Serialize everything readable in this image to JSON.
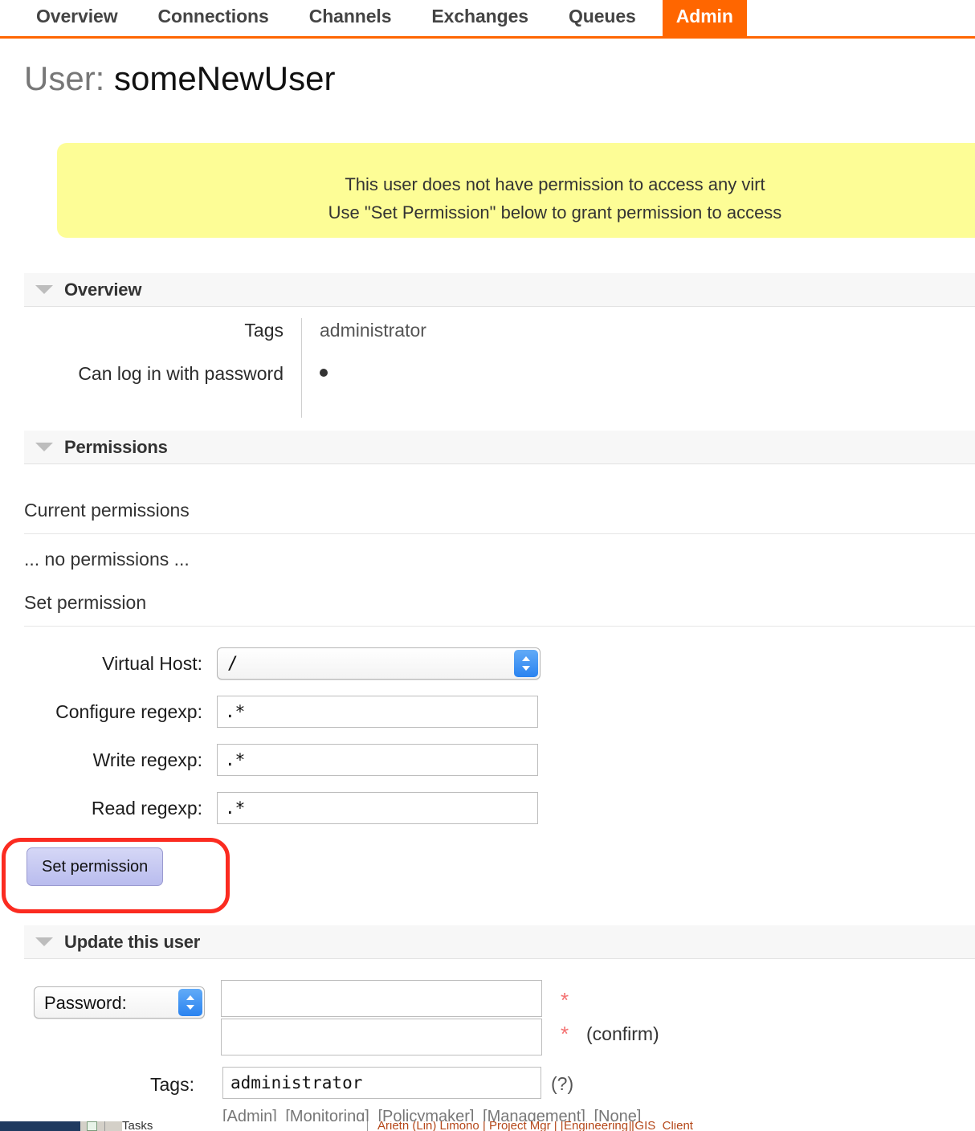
{
  "nav": {
    "items": [
      {
        "label": "Overview",
        "active": false
      },
      {
        "label": "Connections",
        "active": false
      },
      {
        "label": "Channels",
        "active": false
      },
      {
        "label": "Exchanges",
        "active": false
      },
      {
        "label": "Queues",
        "active": false
      },
      {
        "label": "Admin",
        "active": true
      }
    ],
    "accent_color": "#ff6600"
  },
  "page": {
    "title_prefix": "User:",
    "title_user": "someNewUser"
  },
  "warning": {
    "line1": "This user does not have permission to access any virt",
    "line2": "Use \"Set Permission\" below to grant permission to access",
    "background_color": "#fdfd96"
  },
  "overview": {
    "heading": "Overview",
    "rows": [
      {
        "label": "Tags",
        "value": "administrator"
      },
      {
        "label": "Can log in with password",
        "value": "●"
      }
    ]
  },
  "permissions": {
    "heading": "Permissions",
    "current_label": "Current permissions",
    "none_text": "... no permissions ...",
    "set_label": "Set permission",
    "form": {
      "vhost_label": "Virtual Host:",
      "vhost_value": "/",
      "configure_label": "Configure regexp:",
      "configure_value": ".*",
      "write_label": "Write regexp:",
      "write_value": ".*",
      "read_label": "Read regexp:",
      "read_value": ".*",
      "submit_label": "Set permission"
    }
  },
  "update_user": {
    "heading": "Update this user",
    "password_select_value": "Password:",
    "password_value": "",
    "password_confirm_value": "",
    "required_marker": "*",
    "confirm_label": "(confirm)",
    "tags_label": "Tags:",
    "tags_value": "administrator",
    "tags_help": "(?)",
    "tag_links": [
      "[Admin]",
      "[Monitoring]",
      "[Policymaker]",
      "[Management]",
      "[None]"
    ]
  },
  "annotation": {
    "color": "#fb2b20",
    "target": "set-permission-button"
  },
  "background_window": {
    "cell_text": "Tasks",
    "row_text": "Arietn (Lin) Limono | Project Mgr | [Engineering][GIS_Client"
  }
}
